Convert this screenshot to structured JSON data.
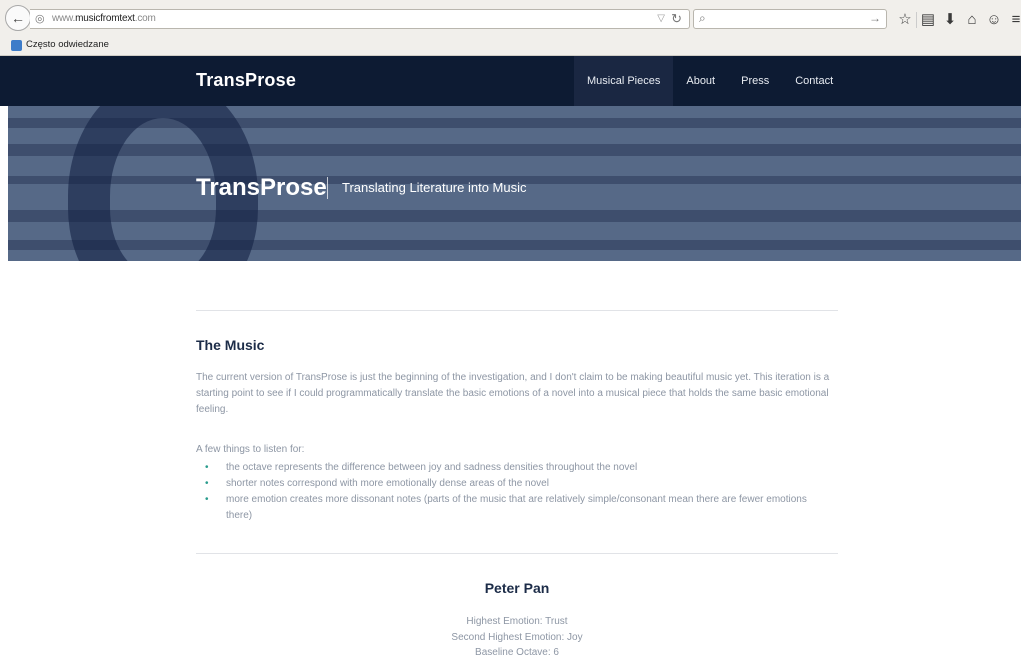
{
  "browser": {
    "url_host": "www.",
    "url_domain": "musicfromtext",
    "url_tld": ".com",
    "bookmark_label": "Często odwiedzane"
  },
  "site": {
    "brand": "TransProse",
    "nav": [
      {
        "label": "Musical Pieces",
        "active": true
      },
      {
        "label": "About",
        "active": false
      },
      {
        "label": "Press",
        "active": false
      },
      {
        "label": "Contact",
        "active": false
      }
    ]
  },
  "hero": {
    "title": "TransProse",
    "subtitle": "Translating Literature into Music"
  },
  "music": {
    "title": "The Music",
    "paragraph_lines": [
      "The current version of TransProse is just the beginning of the investigation, and I don't claim to be making beautiful music yet. This iteration is a",
      "starting point to see if I could programmatically translate the basic emotions of a novel into a musical piece that holds the same basic emotional",
      "feeling."
    ],
    "listen_intro": "A few things to listen for:",
    "bullets": [
      {
        "line1": "the octave represents the difference between joy and sadness densities throughout the novel",
        "line2": ""
      },
      {
        "line1": "shorter notes correspond with more emotionally dense areas of the novel",
        "line2": ""
      },
      {
        "line1": "more emotion creates more dissonant notes (parts of the music that are relatively simple/consonant mean there are fewer emotions",
        "line2": "there)"
      }
    ]
  },
  "piece": {
    "title": "Peter Pan",
    "stats": [
      "Highest Emotion: Trust",
      "Second Highest Emotion: Joy",
      "Baseline Octave: 6"
    ]
  },
  "colors": {
    "nav_bg": "#0d1b33",
    "hero_bg": "#566987",
    "heading": "#1c2c48",
    "body_text": "#8d96a4",
    "bullet_accent": "#2a9c8d"
  }
}
